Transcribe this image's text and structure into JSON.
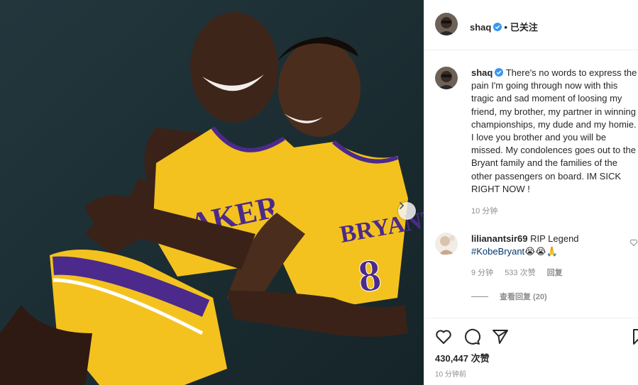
{
  "post": {
    "username": "shaq",
    "follow_status": "已关注",
    "header_dot": "•",
    "caption_text": "There's no words to express the pain I'm going through now with this tragic and sad moment of loosing my friend, my brother, my partner in winning championships, my dude and my homie. I love you brother and you will be missed. My condolences goes out to the Bryant family and the families of the other passengers on board. IM SICK RIGHT NOW !",
    "caption_time": "10 分钟",
    "likes": "430,447 次赞",
    "post_time": "10 分钟前"
  },
  "comment": {
    "username": "lilianantsir69",
    "text": "RIP Legend",
    "hashtag": "#KobeBryant",
    "emoji": "😭😭🙏",
    "time": "9 分钟",
    "likes": "533 次赞",
    "reply_label": "回复",
    "view_replies": "查看回复 (20)"
  },
  "photo": {
    "jersey_front_text": "LAKERS",
    "jersey_back_name": "BRYANT",
    "jersey_back_number": "8"
  },
  "icons": {
    "verified": "verified-badge-icon",
    "next": "chevron-right-icon",
    "like": "heart-icon",
    "comment": "speech-bubble-icon",
    "share": "paper-plane-icon",
    "save": "bookmark-icon"
  },
  "colors": {
    "verified_blue": "#3897f0",
    "lakers_gold": "#f4c21f",
    "lakers_purple": "#4b2a8c",
    "text_primary": "#262626",
    "text_secondary": "#8e8e8e"
  }
}
